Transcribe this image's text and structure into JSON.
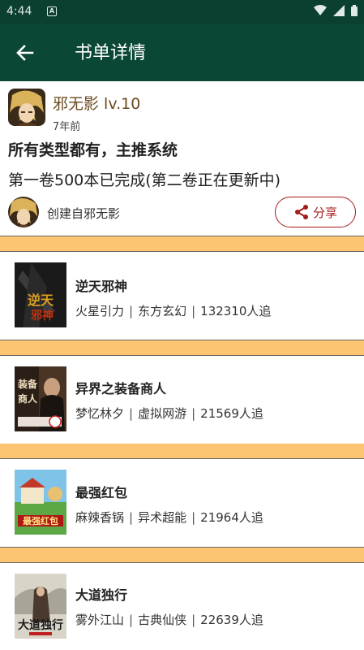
{
  "status_bar": {
    "time": "4:44",
    "notification": "A",
    "icons": [
      "wifi-icon",
      "signal-icon",
      "battery-icon"
    ]
  },
  "app_bar": {
    "title": "书单详情",
    "back_icon": "arrow-left-icon"
  },
  "booklist": {
    "author_name": "邪无影  lv.10",
    "time_ago": "7年前",
    "title": "所有类型都有，主推系统",
    "description": "第一卷500本已完成(第二卷正在更新中)",
    "creator": "创建自邪无影",
    "share_label": "分享"
  },
  "books": [
    {
      "title": "逆天邪神",
      "author": "火星引力",
      "category": "东方玄幻",
      "followers": "132310人追"
    },
    {
      "title": "异界之装备商人",
      "author": "梦忆林夕",
      "category": "虚拟网游",
      "followers": "21569人追"
    },
    {
      "title": "最强红包",
      "author": "麻辣香锅",
      "category": "异术超能",
      "followers": "21964人追"
    },
    {
      "title": "大道独行",
      "author": "雾外江山",
      "category": "古典仙侠",
      "followers": "22639人追"
    }
  ],
  "colors": {
    "app_bar": "#0b4736",
    "status_bar": "#0b3f31",
    "divider": "#fdc572",
    "share_accent": "#a51c1c",
    "author_name": "#6b4a1f"
  }
}
